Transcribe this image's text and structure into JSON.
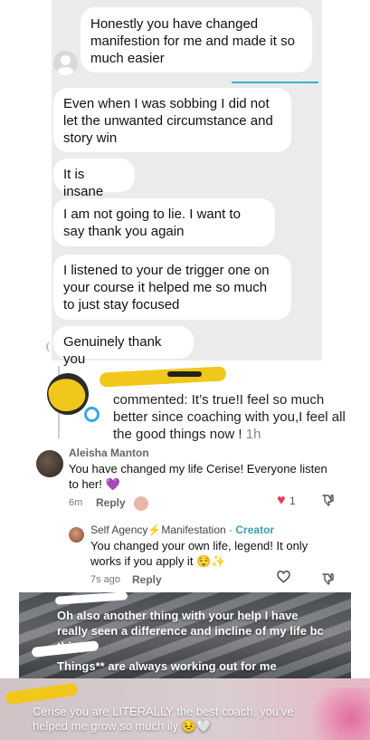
{
  "chat": {
    "messages": [
      "Honestly you have changed manifestion for me and made it so much easier",
      "Even when I was sobbing I did not let the unwanted circumstance and story win",
      "It is insane",
      "I am not going to lie. I want to say thank you again",
      "I listened to your de trigger one on your course it helped me so much to just stay focused",
      "Genuinely thank you"
    ]
  },
  "comment1": {
    "text": "commented: It’s true!I feel so much better since coaching with you,I feel all the good things now !",
    "time": "1h"
  },
  "comment2": {
    "name": "Aleisha Manton",
    "text": "You have changed my life Cerise! Everyone listen to her!",
    "emoji": "💜",
    "time": "6m",
    "reply_label": "Reply",
    "like_count": "1"
  },
  "reply1": {
    "name": "Self Agency⚡Manifestation",
    "separator": "·",
    "badge": "Creator",
    "text": "You changed your own life, legend! It only works if you apply it",
    "emoji": "😌✨",
    "time": "7s ago",
    "reply_label": "Reply"
  },
  "story1": {
    "line1": "Oh also another thing with your help I have really seen a difference and incline of my life bc thing",
    "line2": "Things** are always working out for me"
  },
  "story2": {
    "text": "Cerise you are LITERALLY the best coach, you’ve helped me grow so much ily",
    "emoji": "😣🤍"
  },
  "colors": {
    "chat_bg": "#ebebeb",
    "highlight_yellow": "#f2c71c",
    "creator_teal": "#3b9fb0",
    "like_red": "#e83a5a",
    "purple_heart": "#8b3fd9"
  }
}
